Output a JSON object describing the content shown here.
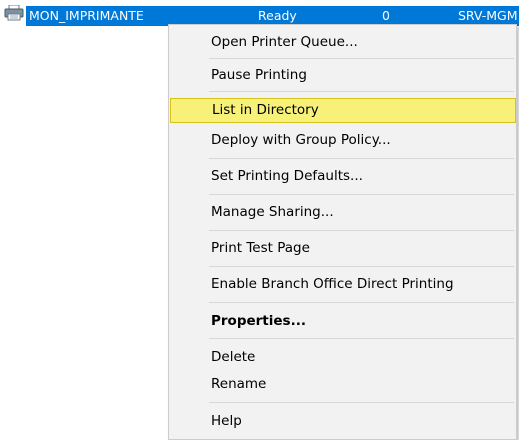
{
  "printer_row": {
    "name": "MON_IMPRIMANTE",
    "status": "Ready",
    "jobs": "0",
    "server": "SRV-MGM",
    "icon": "printer-icon"
  },
  "colors": {
    "selection": "#0078d7",
    "menu_background": "#f2f2f2",
    "hover_background": "#f7f17a",
    "hover_border": "#d6c21a"
  },
  "context_menu": {
    "items": [
      {
        "label": "Open Printer Queue..."
      },
      {
        "label": "Pause Printing"
      },
      {
        "label": "List in Directory",
        "state": "hovered"
      },
      {
        "label": "Deploy with Group Policy..."
      },
      {
        "label": "Set Printing Defaults..."
      },
      {
        "label": "Manage Sharing..."
      },
      {
        "label": "Print Test Page"
      },
      {
        "label": "Enable Branch Office Direct Printing"
      },
      {
        "label": "Properties...",
        "style": "bold"
      },
      {
        "label": "Delete"
      },
      {
        "label": "Rename"
      },
      {
        "label": "Help"
      }
    ]
  }
}
